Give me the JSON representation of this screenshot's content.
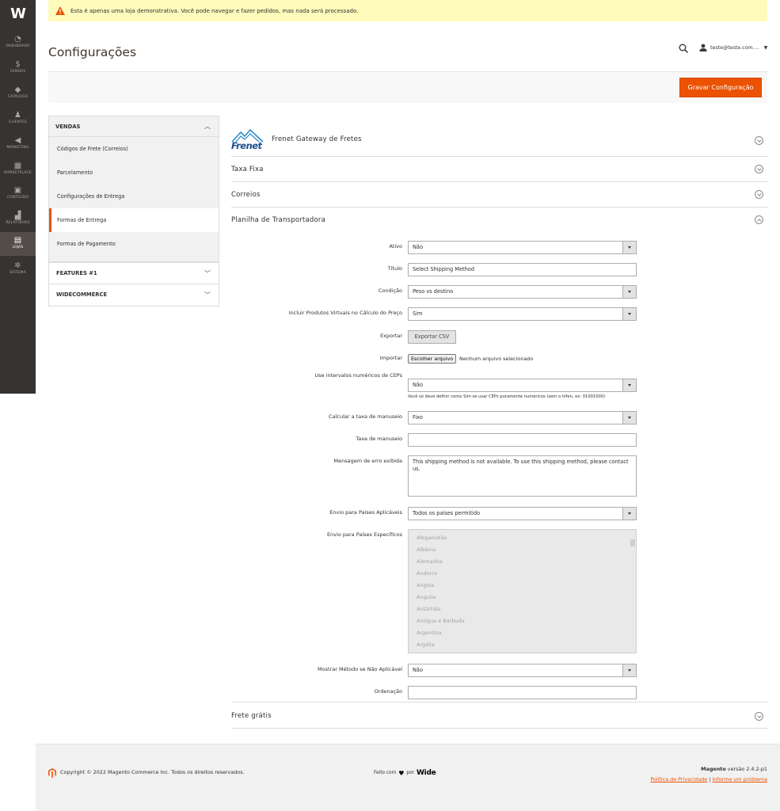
{
  "nav": {
    "logo": "W",
    "items": [
      {
        "label": "DASHBOARD",
        "icon": "dashboard-icon",
        "glyph": "◔"
      },
      {
        "label": "VENDAS",
        "icon": "dollar-icon",
        "glyph": "$"
      },
      {
        "label": "CATÁLOGO",
        "icon": "box-icon",
        "glyph": "◆"
      },
      {
        "label": "CLIENTES",
        "icon": "person-icon",
        "glyph": "♟"
      },
      {
        "label": "MARKETING",
        "icon": "megaphone-icon",
        "glyph": "◀"
      },
      {
        "label": "MARKETPLACE",
        "icon": "storefront-icon",
        "glyph": "▦"
      },
      {
        "label": "CONTEÚDO",
        "icon": "content-icon",
        "glyph": "▣"
      },
      {
        "label": "RELATÓRIOS",
        "icon": "bar-chart-icon",
        "glyph": "▟"
      },
      {
        "label": "LOJAS",
        "icon": "store-icon",
        "glyph": "▤"
      },
      {
        "label": "SISTEMA",
        "icon": "gear-icon",
        "glyph": "✲"
      }
    ],
    "active_index": 8
  },
  "notice": {
    "text": "Esta é apenas uma loja demonstrativa. Você pode navegar e fazer pedidos, mas nada será processado."
  },
  "header": {
    "title": "Configurações",
    "user": "teste@teste.com...."
  },
  "actions": {
    "save_label": "Gravar Configuração"
  },
  "tabs": {
    "vendas": {
      "title": "VENDAS",
      "items": [
        "Códigos de Frete (Correios)",
        "Parcelamento",
        "Configurações de Entrega",
        "Formas de Entrega",
        "Formas de Pagamento"
      ],
      "active_index": 3
    },
    "features": "FEATURES #1",
    "widecommerce": "WIDECOMMERCE"
  },
  "sections": {
    "frenet": {
      "title": "Frenet Gateway de Fretes",
      "logo_text": "Frenet"
    },
    "taxa_fixa": "Taxa Fixa",
    "correios": "Correios",
    "planilha": "Planilha de Transportadora",
    "frete_gratis": "Frete grátis"
  },
  "form": {
    "ativo": {
      "label": "Ativo",
      "value": "Não"
    },
    "titulo": {
      "label": "Título",
      "value": "Select Shipping Method"
    },
    "condicao": {
      "label": "Condição",
      "value": "Peso vs destino"
    },
    "incluir_virtuais": {
      "label": "Incluir Produtos Virtuais no Cálculo do Preço",
      "value": "Sim"
    },
    "exportar": {
      "label": "Exportar",
      "button": "Exportar CSV"
    },
    "importar": {
      "label": "Importar",
      "button": "Escolher arquivo",
      "status": "Nenhum arquivo selecionado"
    },
    "intervalos": {
      "label": "Use intervalos numéricos de CEPs",
      "value": "Não",
      "note": "Você só deve definir como Sim se usar CEPs puramente numéricos (sem o hífen, ex: 01001000)"
    },
    "calcular_taxa": {
      "label": "Calcular a taxa de manuseio",
      "value": "Fixo"
    },
    "taxa_manuseio": {
      "label": "Taxa de manuseio",
      "value": ""
    },
    "mensagem_erro": {
      "label": "Mensagem de erro exibida",
      "value": "This shipping method is not available. To use this shipping method, please contact us."
    },
    "envio_aplicaveis": {
      "label": "Envio para Países Aplicáveis",
      "value": "Todos os países permitido"
    },
    "envio_especificos": {
      "label": "Envio para Países Específicos",
      "options": [
        "Afeganistão",
        "Albânia",
        "Alemanha",
        "Andorra",
        "Angola",
        "Anguila",
        "Antártida",
        "Antígua e Barbuda",
        "Argentina",
        "Argélia"
      ]
    },
    "mostrar_metodo": {
      "label": "Mostrar Método se Não Aplicável",
      "value": "Não"
    },
    "ordenacao": {
      "label": "Ordenação",
      "value": ""
    }
  },
  "footer": {
    "copyright": "Copyright © 2022 Magento Commerce Inc. Todos os direitos reservados.",
    "made_with": "Feito com",
    "por": "por",
    "wide_logo": "Wide",
    "brand": "Magento",
    "version": "versão 2.4.2-p1",
    "privacy": "Política de Privacidade",
    "separator": "|",
    "report": "Informe um problema"
  },
  "colors": {
    "accent": "#eb5202",
    "nav_bg": "#373330",
    "notice_bg": "#fffbbb",
    "frenet_blue": "#1d4f8c"
  }
}
